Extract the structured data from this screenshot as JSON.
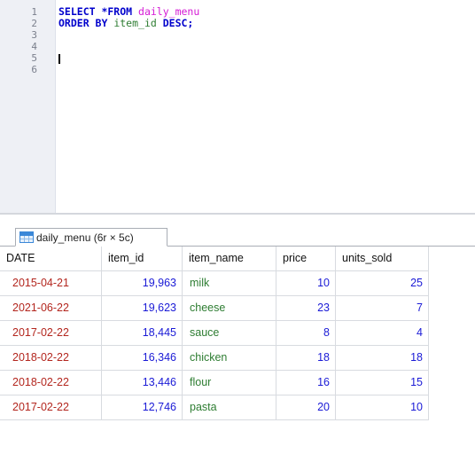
{
  "editor": {
    "line_numbers": [
      "1",
      "2",
      "3",
      "4",
      "5",
      "6"
    ],
    "line1": {
      "kw1": "SELECT *FROM",
      "table": "daily_menu"
    },
    "line2": {
      "kw1": "ORDER BY",
      "column": "item_id",
      "kw2": "DESC;"
    }
  },
  "result_tab": {
    "icon": "table-grid-icon",
    "label": "daily_menu (6r × 5c)"
  },
  "grid": {
    "headers": [
      "DATE",
      "item_id",
      "item_name",
      "price",
      "units_sold"
    ],
    "rows": [
      [
        "2015-04-21",
        "19,963",
        "milk",
        "10",
        "25"
      ],
      [
        "2021-06-22",
        "19,623",
        "cheese",
        "23",
        "7"
      ],
      [
        "2017-02-22",
        "18,445",
        "sauce",
        "8",
        "4"
      ],
      [
        "2018-02-22",
        "16,346",
        "chicken",
        "18",
        "18"
      ],
      [
        "2018-02-22",
        "13,446",
        "flour",
        "16",
        "15"
      ],
      [
        "2017-02-22",
        "12,746",
        "pasta",
        "20",
        "10"
      ]
    ]
  },
  "colors": {
    "keyword": "#0000cc",
    "identifier": "#d51ad5",
    "column": "#2e7d32",
    "date": "#b3261e",
    "number": "#1a1ad6",
    "text": "#2e7d32"
  }
}
